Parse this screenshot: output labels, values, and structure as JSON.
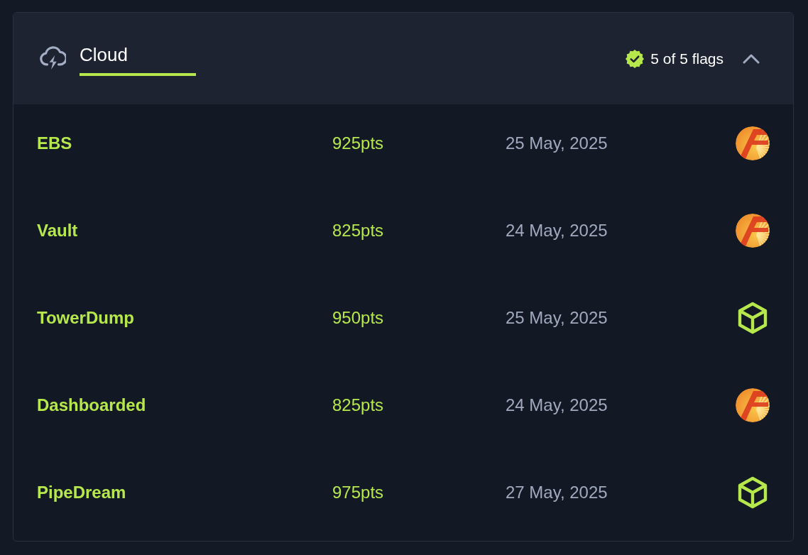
{
  "section": {
    "title": "Cloud",
    "status": "5 of 5 flags",
    "complete": true,
    "expanded": true
  },
  "flags": [
    {
      "name": "EBS",
      "points": "925pts",
      "date": "25 May, 2025",
      "kind": "badge"
    },
    {
      "name": "Vault",
      "points": "825pts",
      "date": "24 May, 2025",
      "kind": "badge"
    },
    {
      "name": "TowerDump",
      "points": "950pts",
      "date": "25 May, 2025",
      "kind": "cube"
    },
    {
      "name": "Dashboarded",
      "points": "825pts",
      "date": "24 May, 2025",
      "kind": "badge"
    },
    {
      "name": "PipeDream",
      "points": "975pts",
      "date": "27 May, 2025",
      "kind": "cube"
    }
  ]
}
